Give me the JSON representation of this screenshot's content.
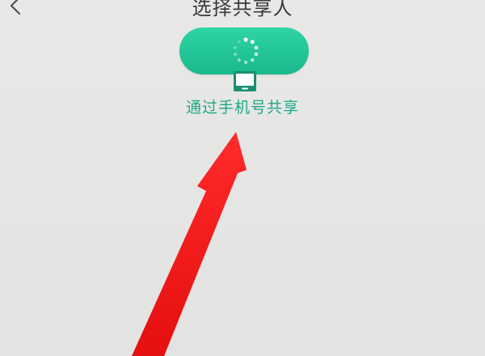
{
  "header": {
    "title": "选择共享人",
    "back_icon": "chevron-left-icon"
  },
  "share_option": {
    "label": "通过手机号共享",
    "button_icon": "loading-spinner-icon",
    "device_icon": "phone-icon",
    "accent_color": "#1ea985"
  },
  "annotation": {
    "arrow_color": "#ff1a1a"
  }
}
